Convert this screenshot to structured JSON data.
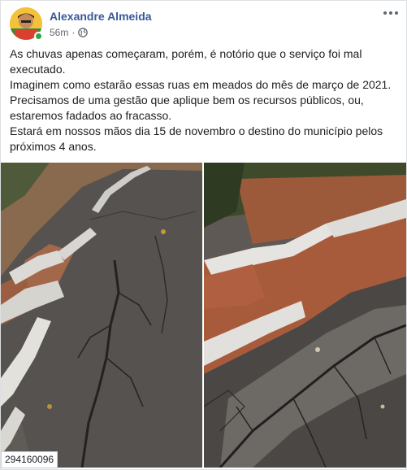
{
  "post": {
    "author": "Alexandre Almeida",
    "time": "56m",
    "separator": "·",
    "privacy_icon": "globe-icon",
    "more_icon": "more-horizontal-icon",
    "paragraphs": [
      "As chuvas apenas começaram, porém, é notório que o serviço foi mal executado.",
      "Imaginem como estarão essas ruas em meados do mês de março de 2021.",
      "Precisamos de uma gestão que aplique bem os recursos públicos, ou, estaremos fadados ao fracasso.",
      "Estará em nossos mãos dia 15 de novembro o destino do município pelos próximos 4 anos."
    ]
  },
  "overlay": {
    "id_text": "294160096"
  },
  "colors": {
    "author_link": "#385898",
    "meta_text": "#616770",
    "online": "#31a24c"
  }
}
